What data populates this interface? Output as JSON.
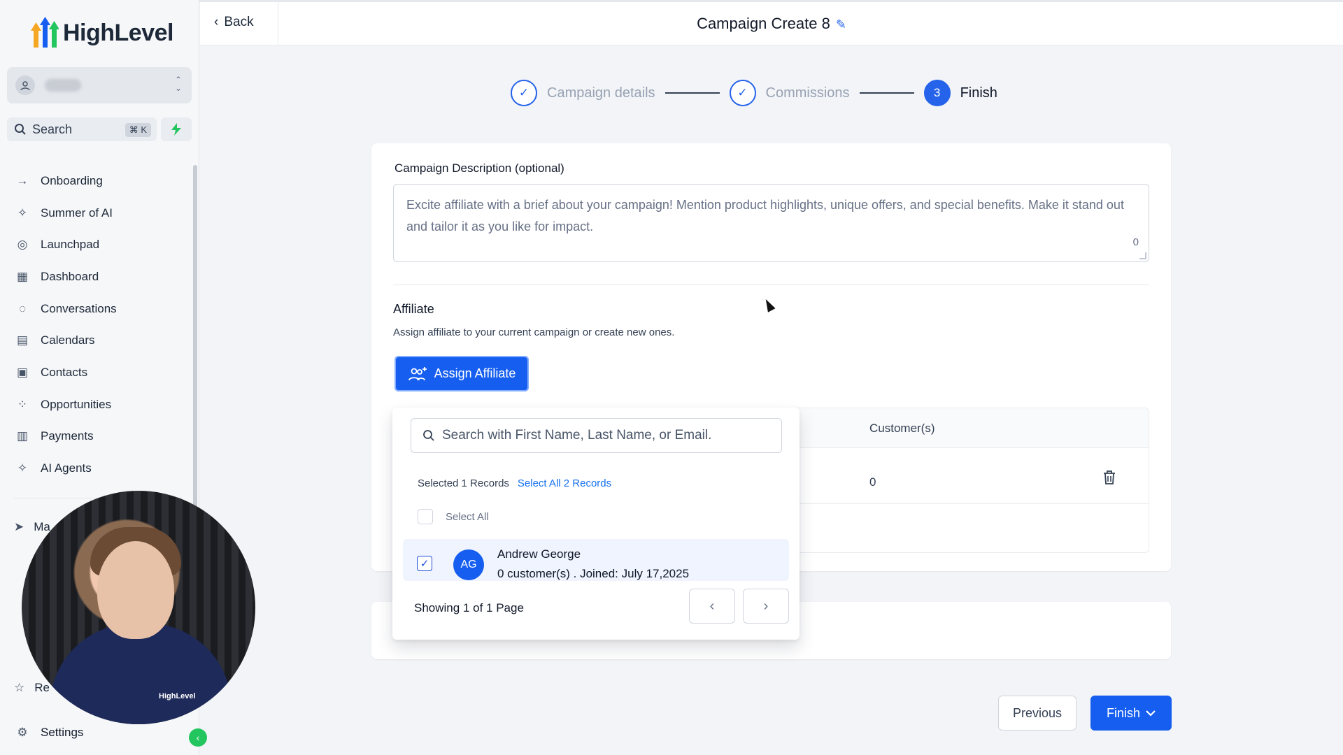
{
  "app": {
    "brand": "HighLevel",
    "brand_color": "#155eef"
  },
  "sidebar": {
    "search_label": "Search",
    "search_shortcut": "⌘ K",
    "items": [
      {
        "label": "Onboarding",
        "icon": "arrow-right-icon"
      },
      {
        "label": "Summer of AI",
        "icon": "sparkle-icon"
      },
      {
        "label": "Launchpad",
        "icon": "rocket-icon"
      },
      {
        "label": "Dashboard",
        "icon": "grid-icon"
      },
      {
        "label": "Conversations",
        "icon": "chat-icon"
      },
      {
        "label": "Calendars",
        "icon": "calendar-icon"
      },
      {
        "label": "Contacts",
        "icon": "contacts-icon"
      },
      {
        "label": "Opportunities",
        "icon": "opportunities-icon"
      },
      {
        "label": "Payments",
        "icon": "payments-icon"
      },
      {
        "label": "AI Agents",
        "icon": "sparkle-icon"
      }
    ],
    "lower_items": [
      {
        "label": "Ma",
        "icon": "send-icon"
      },
      {
        "label": "Re",
        "icon": "star-icon"
      }
    ],
    "settings_label": "Settings"
  },
  "header": {
    "back_label": "Back",
    "title": "Campaign Create 8"
  },
  "stepper": {
    "steps": [
      {
        "label": "Campaign details",
        "marker": "✓"
      },
      {
        "label": "Commissions",
        "marker": "✓"
      },
      {
        "label": "Finish",
        "marker": "3"
      }
    ]
  },
  "form": {
    "description_label": "Campaign Description (optional)",
    "description_placeholder": "Excite affiliate with a brief about your campaign! Mention product highlights, unique offers, and special benefits. Make it stand out and tailor it as you like for impact.",
    "description_count": "0",
    "affiliate_title": "Affiliate",
    "affiliate_desc": "Assign affiliate to your current campaign or create new ones.",
    "assign_button": "Assign Affiliate"
  },
  "table": {
    "header_customers": "Customer(s)",
    "row_customers": "0"
  },
  "dropdown": {
    "search_placeholder": "Search with First Name, Last Name, or Email.",
    "selected_text": "Selected 1 Records",
    "select_all_link": "Select All 2 Records",
    "select_all_label": "Select All",
    "record": {
      "initials": "AG",
      "name": "Andrew George",
      "meta": "0 customer(s) . Joined: July 17,2025"
    },
    "pagination_text": "Showing 1 of 1 Page"
  },
  "footer": {
    "previous": "Previous",
    "finish": "Finish"
  },
  "webcam": {
    "logo_text": "HighLevel"
  }
}
